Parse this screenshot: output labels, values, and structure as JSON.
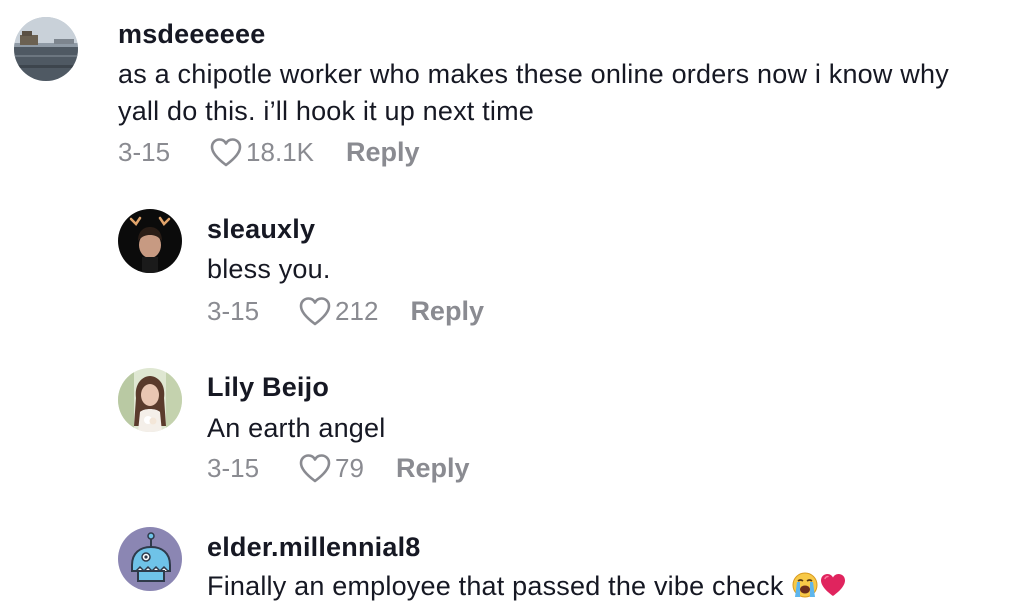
{
  "comments": [
    {
      "username": "msdeeeeee",
      "lines": [
        "as a chipotle worker who makes these online orders now i know why",
        "yall do this. i’ll hook it up next time"
      ],
      "date": "3-15",
      "likes": "18.1K",
      "reply_label": "Reply"
    },
    {
      "username": "sleauxly",
      "lines": [
        "bless you."
      ],
      "date": "3-15",
      "likes": "212",
      "reply_label": "Reply"
    },
    {
      "username": "Lily Beijo",
      "lines": [
        "An earth angel"
      ],
      "date": "3-15",
      "likes": "79",
      "reply_label": "Reply"
    },
    {
      "username": "elder.millennial8",
      "lines": [
        "Finally an employee that passed the vibe check"
      ],
      "date": "",
      "likes": "",
      "reply_label": "",
      "emojis": [
        "loudly-crying-face",
        "red-heart"
      ]
    }
  ],
  "icons": {
    "like": "heart-outline-icon"
  },
  "colors": {
    "text_primary": "#161823",
    "text_secondary": "#8a8b91",
    "background": "#ffffff",
    "avatar_robot_bg": "#8b86b3"
  }
}
